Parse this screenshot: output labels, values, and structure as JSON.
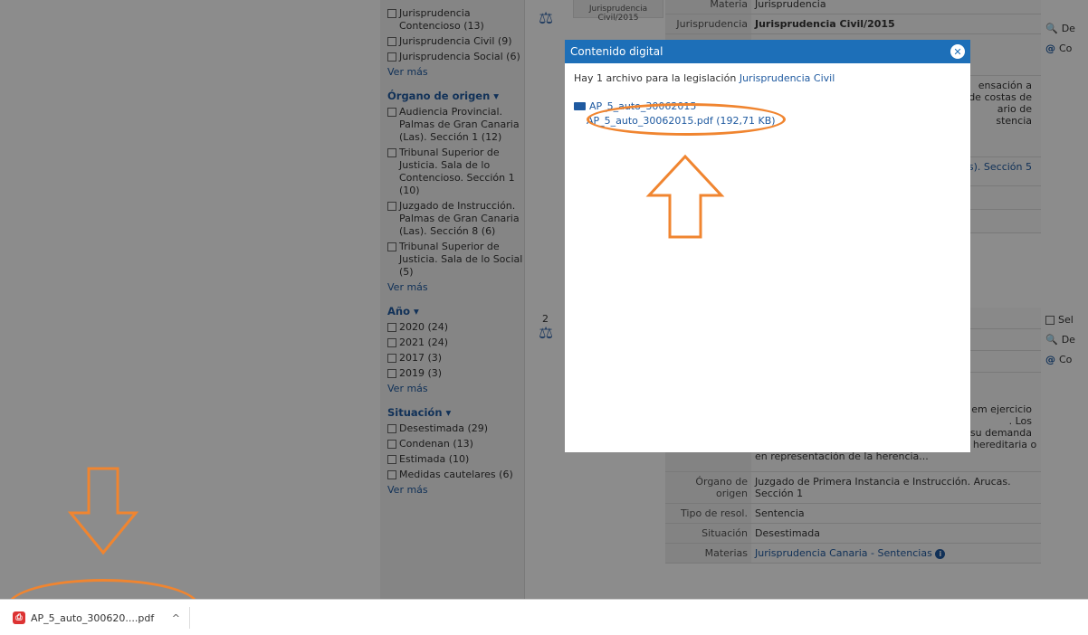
{
  "filters": {
    "jurisdiccion_items": [
      {
        "label": "Jurisprudencia Contencioso (13)"
      },
      {
        "label": "Jurisprudencia Civil (9)"
      },
      {
        "label": "Jurisprudencia Social (6)"
      }
    ],
    "ver_mas": "Ver más",
    "organo": {
      "title": "Órgano de origen ▾",
      "items": [
        {
          "label": "Audiencia Provincial. Palmas de Gran Canaria (Las). Sección 1 (12)"
        },
        {
          "label": "Tribunal Superior de Justicia. Sala de lo Contencioso. Sección 1 (10)"
        },
        {
          "label": "Juzgado de Instrucción. Palmas de Gran Canaria (Las). Sección 8 (6)"
        },
        {
          "label": "Tribunal Superior de Justicia. Sala de lo Social (5)"
        }
      ]
    },
    "anio": {
      "title": "Año ▾",
      "items": [
        {
          "label": "2020 (24)"
        },
        {
          "label": "2021 (24)"
        },
        {
          "label": "2017 (3)"
        },
        {
          "label": "2019 (3)"
        }
      ]
    },
    "situacion": {
      "title": "Situación ▾",
      "items": [
        {
          "label": "Desestimada (29)"
        },
        {
          "label": "Condenan (13)"
        },
        {
          "label": "Estimada (10)"
        },
        {
          "label": "Medidas cautelares (6)"
        }
      ]
    }
  },
  "result1": {
    "card_line1": "Jurisprudencia",
    "card_line2": "Civil/2015",
    "rows": [
      {
        "k": "Materia",
        "v": "Jurisprudencia"
      },
      {
        "k": "Jurisprudencia",
        "v": "Jurisprudencia Civil/2015"
      }
    ],
    "snippet_frag1": "ensación a",
    "snippet_frag2": "de costas de",
    "snippet_frag3": "ario de",
    "snippet_frag4": "stencia",
    "snippet_frag5": "as). Sección 5"
  },
  "result2": {
    "number": "2",
    "snippet_frag1": "em ejercicio",
    "snippet_frag2": ". Los",
    "snippet_frag3": "e su demanda",
    "snippet_tail": "que actuen en interés o para la comunidad hereditaria o en representación de la herencia...",
    "rows": [
      {
        "k": "Órgano de origen",
        "v": "Juzgado de Primera Instancia e Instrucción. Arucas. Sección 1"
      },
      {
        "k": "Tipo de resol.",
        "v": "Sentencia"
      },
      {
        "k": "Situación",
        "v": "Desestimada"
      },
      {
        "k": "Materias",
        "v": "Jurisprudencia Canaria - Sentencias"
      }
    ]
  },
  "right_actions": {
    "sel": "Sel",
    "det": "De",
    "co": "Co"
  },
  "modal": {
    "title": "Contenido digital",
    "header_text": "Hay 1 archivo para la legislación",
    "header_link": "Jurisprudencia Civil",
    "folder_name": "AP_5_auto_30062015",
    "file_name": "AP_5_auto_30062015.pdf (192,71 KB)"
  },
  "download": {
    "file_label": "AP_5_auto_300620....pdf",
    "chevron": "^"
  },
  "colors": {
    "accent_blue": "#1d6fb8",
    "link_blue": "#1f5aa0",
    "annotation_orange": "#f08530",
    "pdf_red": "#d33"
  }
}
